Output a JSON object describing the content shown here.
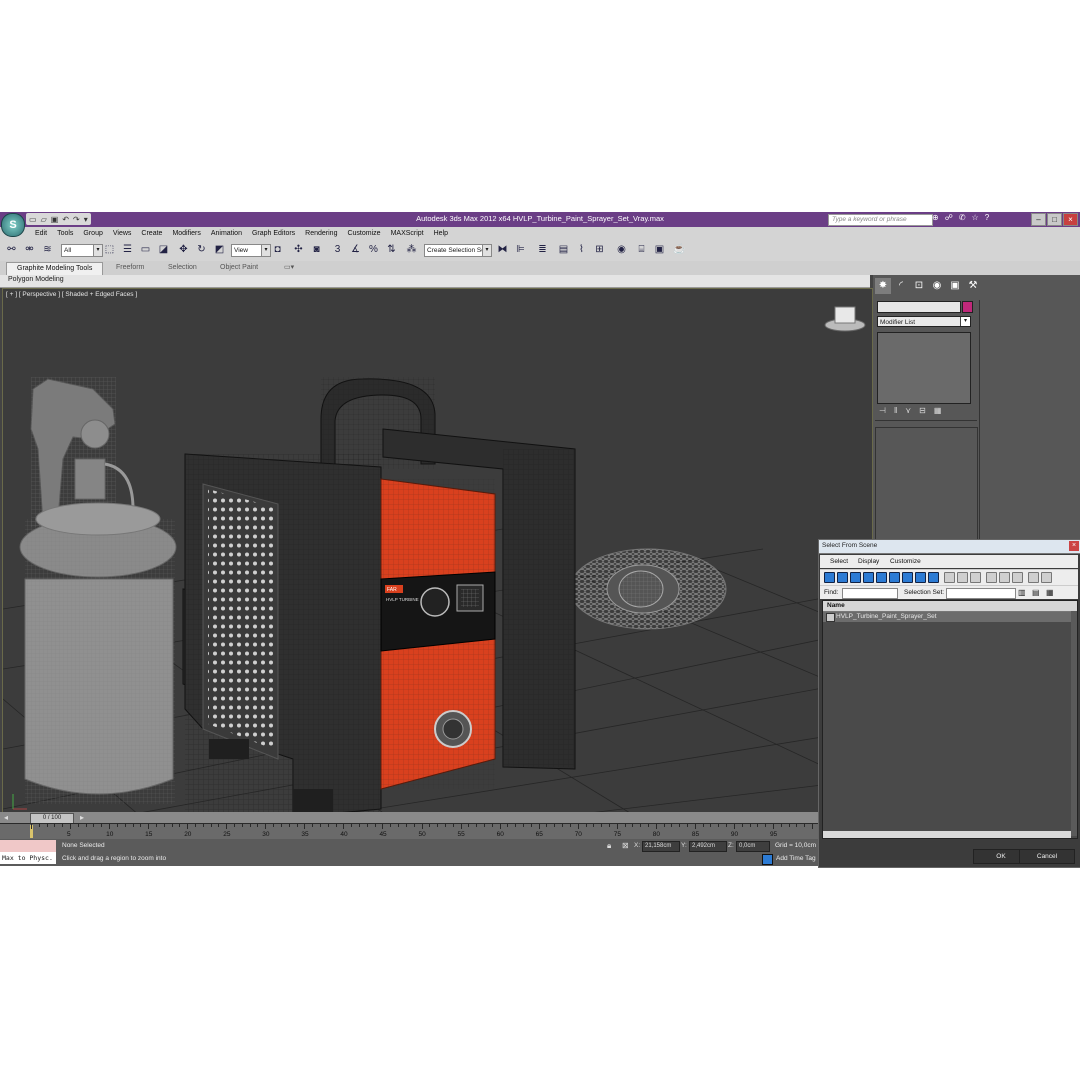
{
  "titlebar": {
    "app_button": "S",
    "title": "Autodesk 3ds Max  2012 x64      HVLP_Turbine_Paint_Sprayer_Set_Vray.max",
    "search_placeholder": "Type a keyword or phrase"
  },
  "menubar": {
    "items": [
      "Edit",
      "Tools",
      "Group",
      "Views",
      "Create",
      "Modifiers",
      "Animation",
      "Graph Editors",
      "Rendering",
      "Customize",
      "MAXScript",
      "Help"
    ]
  },
  "toolbar": {
    "selection_filter": "All",
    "ref_coord": "View",
    "named_selection": "Create Selection Se"
  },
  "ribbon": {
    "tabs": [
      "Graphite Modeling Tools",
      "Freeform",
      "Selection",
      "Object Paint"
    ],
    "panel_label": "Polygon Modeling"
  },
  "viewport": {
    "label": "[ + ] [ Perspective ] [ Shaded + Edged Faces ]",
    "device_label": "HVLP TURBINE",
    "brand_label": "FAR"
  },
  "command_panel": {
    "modifier_list": "Modifier List",
    "colors": {
      "object_color": "#c0287a"
    }
  },
  "timeline": {
    "slider": "0 / 100",
    "ticks": [
      "5",
      "10",
      "15",
      "20",
      "25",
      "30",
      "35",
      "40",
      "45",
      "50",
      "55",
      "60",
      "65",
      "70",
      "75",
      "80",
      "85",
      "90",
      "95"
    ]
  },
  "statusbar": {
    "maxscript": "Max to Physc.",
    "none_selected": "None Selected",
    "prompt": "Click and drag a region to zoom into",
    "x_label": "X:",
    "x_value": "21,158cm",
    "y_label": "Y:",
    "y_value": "2,492cm",
    "z_label": "Z:",
    "z_value": "0,0cm",
    "grid": "Grid = 10,0cm",
    "add_time_tag": "Add Time Tag"
  },
  "dialog": {
    "title": "Select From Scene",
    "menu": [
      "Select",
      "Display",
      "Customize"
    ],
    "find_label": "Find:",
    "selection_set_label": "Selection Set:",
    "column_name": "Name",
    "rows": [
      "HVLP_Turbine_Paint_Sprayer_Set"
    ],
    "ok": "OK",
    "cancel": "Cancel"
  }
}
